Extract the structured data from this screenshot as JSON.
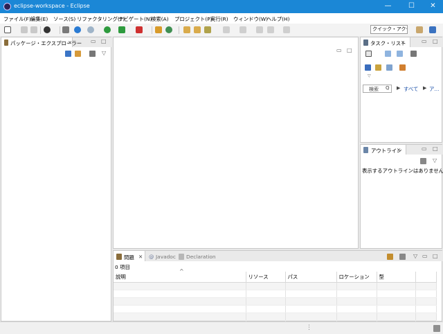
{
  "window": {
    "title": "eclipse-workspace - Eclipse",
    "minimize_glyph": "—",
    "maximize_glyph": "☐",
    "close_glyph": "✕"
  },
  "menu": [
    "ファイル(F)",
    "編集(E)",
    "ソース(S)",
    "リファクタリング(T)",
    "ナビゲート(N)",
    "検索(A)",
    "プロジェクト(P)",
    "実行(R)",
    "ウィンドウ(W)",
    "ヘルプ(H)"
  ],
  "toolbar": {
    "quick_access_label": "クイック・アクセス"
  },
  "package_explorer": {
    "tab_label": "パッケージ・エクスプローラー",
    "close_glyph": "✕"
  },
  "task_list": {
    "tab_label": "タスク・リスト",
    "close_glyph": "✕",
    "find_placeholder": "検索",
    "all_label": "すべて",
    "activate_label": "ア..."
  },
  "outline": {
    "tab_label": "アウトライン",
    "close_glyph": "✕",
    "empty_message": "表示するアウトラインはありません。"
  },
  "bottom": {
    "tabs": [
      {
        "label": "問題",
        "close_glyph": "✕"
      },
      {
        "label": "Javadoc"
      },
      {
        "label": "Declaration"
      }
    ],
    "item_count": "0 項目",
    "columns": [
      "説明",
      "リソース",
      "パス",
      "ロケーション",
      "型"
    ],
    "sort_glyph": "^"
  },
  "statusbar": {
    "grip": "⋮"
  }
}
